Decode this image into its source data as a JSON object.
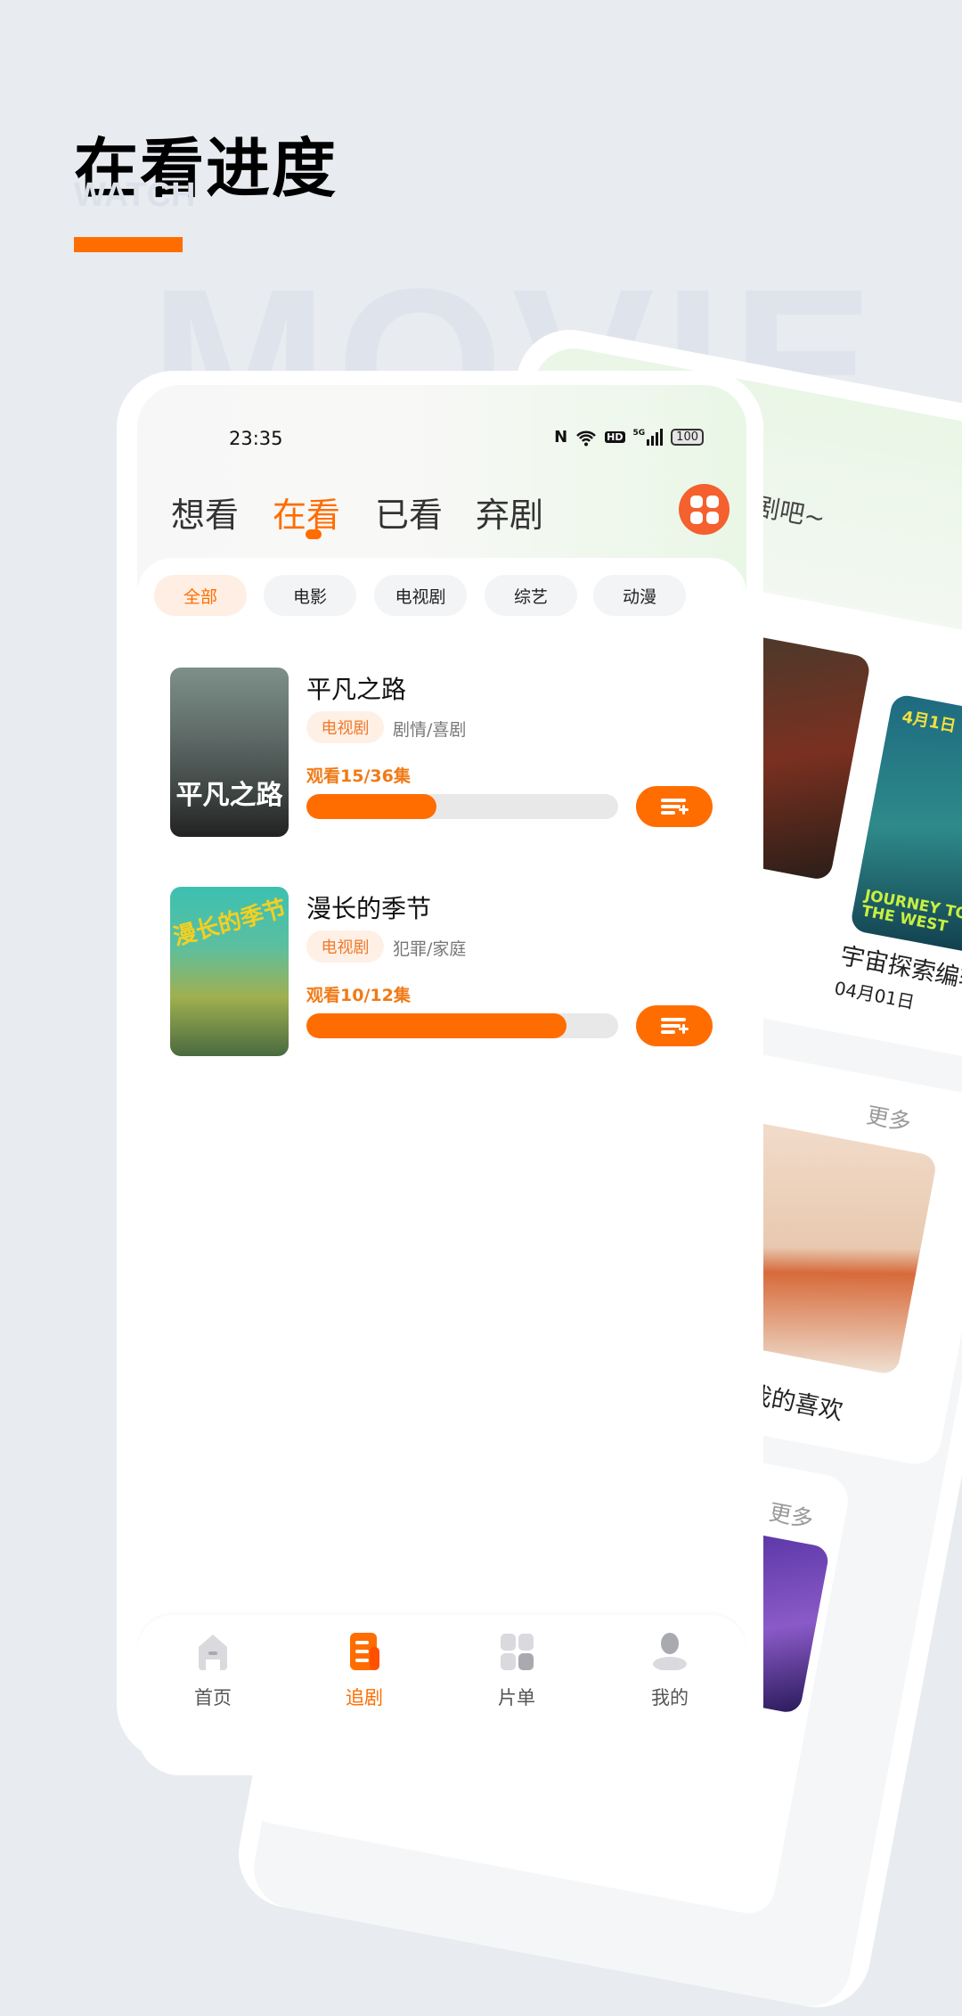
{
  "header": {
    "title": "在看进度",
    "subtitle_watermark": "WATCH",
    "background_watermark": "MOVIE",
    "accent": "#ff6d00"
  },
  "back_phone": {
    "hint_text": "剧吧~",
    "featured_title": "宇宙探索编辑",
    "featured_date": "04月01日",
    "more_1": "更多",
    "card_title": "给我的喜欢",
    "more_2": "更多",
    "poster_text": "JOURNEY TO THE WEST",
    "poster_date": "4月1日"
  },
  "status_bar": {
    "time": "23:35",
    "nfc": "N",
    "network": "5G",
    "hd": "HD",
    "battery": "100"
  },
  "tabs": [
    {
      "label": "想看"
    },
    {
      "label": "在看",
      "active": true
    },
    {
      "label": "已看"
    },
    {
      "label": "弃剧"
    }
  ],
  "grid_button_icon": "grid-icon",
  "filters": [
    {
      "label": "全部",
      "active": true
    },
    {
      "label": "电影"
    },
    {
      "label": "电视剧"
    },
    {
      "label": "综艺"
    },
    {
      "label": "动漫"
    }
  ],
  "items": [
    {
      "title": "平凡之路",
      "poster_text": "平凡之路",
      "type": "电视剧",
      "genre": "剧情/喜剧",
      "progress_text": "观看15/36集",
      "watched": 15,
      "total": 36,
      "action_icon": "playlist-add-icon"
    },
    {
      "title": "漫长的季节",
      "poster_text": "漫长的季节",
      "type": "电视剧",
      "genre": "犯罪/家庭",
      "progress_text": "观看10/12集",
      "watched": 10,
      "total": 12,
      "action_icon": "playlist-add-icon"
    }
  ],
  "bottom_nav": [
    {
      "label": "首页",
      "icon": "home-icon"
    },
    {
      "label": "追剧",
      "icon": "tracking-icon",
      "active": true
    },
    {
      "label": "片单",
      "icon": "list-grid-icon"
    },
    {
      "label": "我的",
      "icon": "profile-icon"
    }
  ]
}
